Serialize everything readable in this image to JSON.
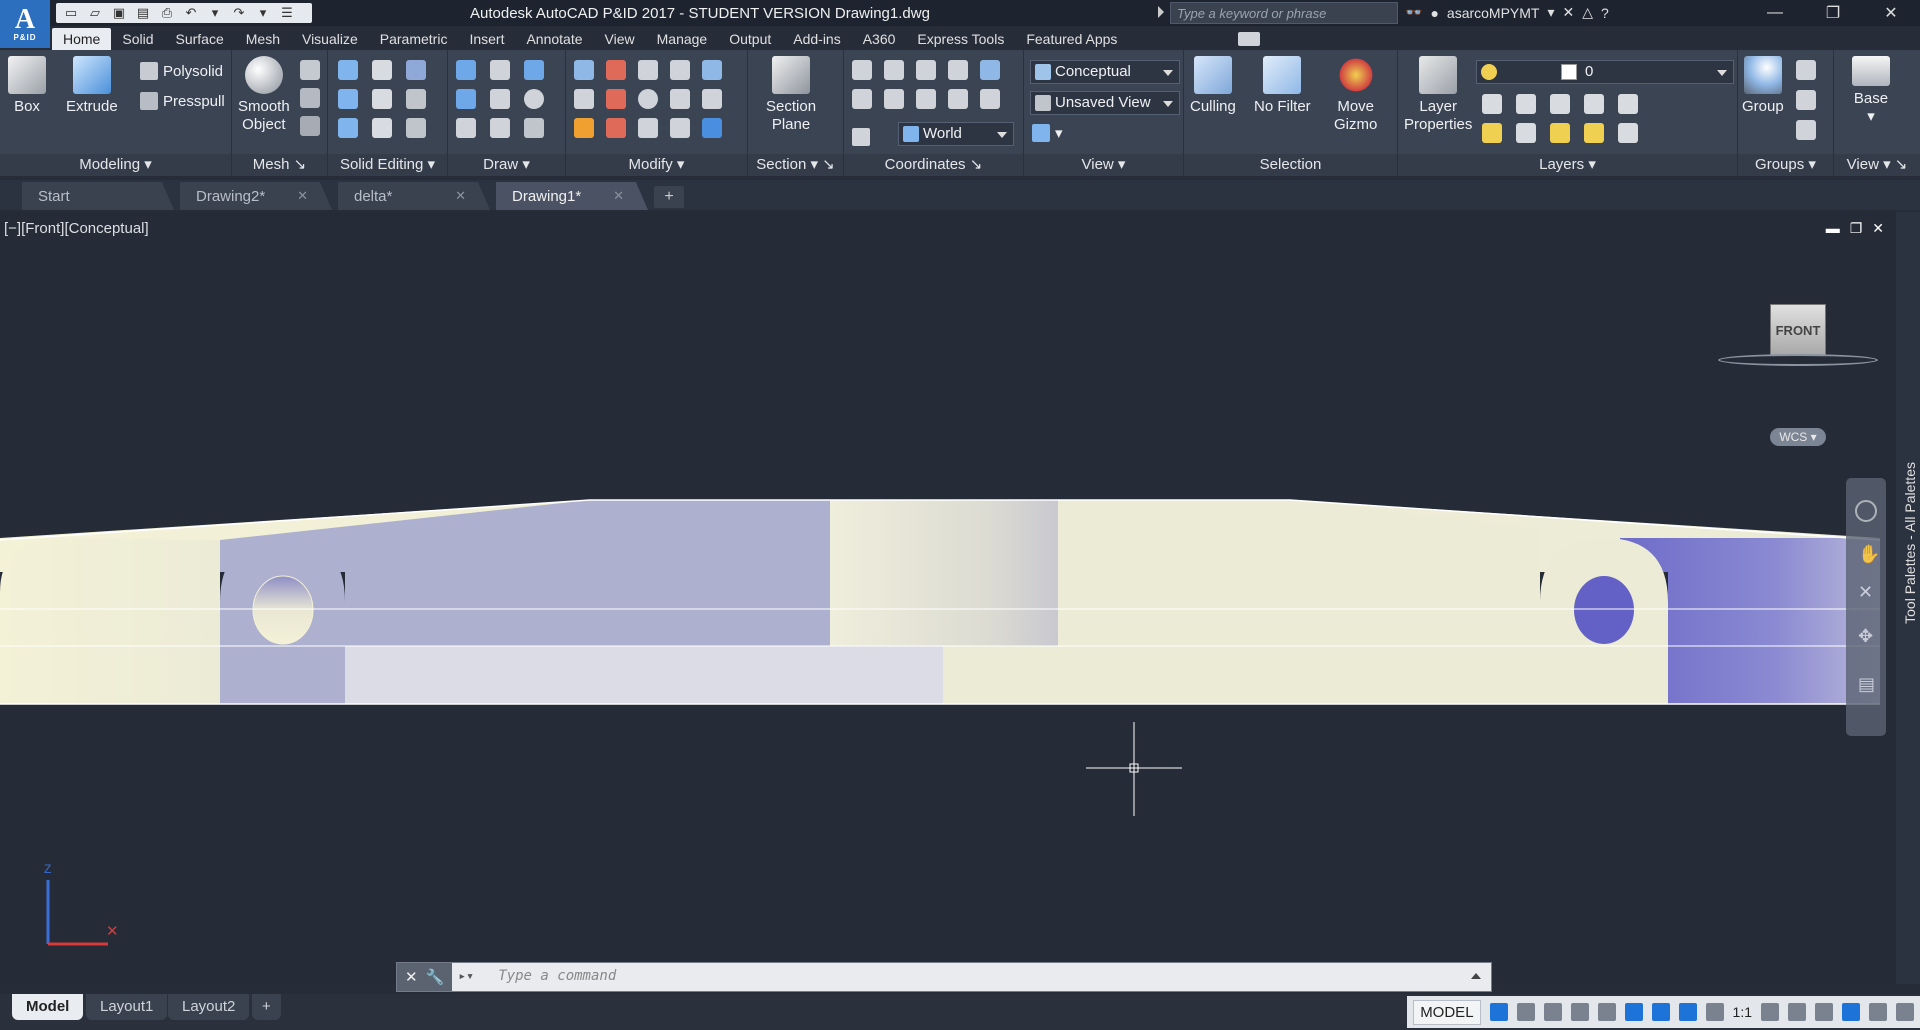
{
  "app": {
    "logo_letter": "A",
    "logo_sub": "P&ID",
    "window_title": "Autodesk AutoCAD P&ID 2017 - STUDENT VERSION    Drawing1.dwg",
    "search_placeholder": "Type a keyword or phrase",
    "username": "asarcoMPYMT"
  },
  "ribbon_tabs": [
    "Home",
    "Solid",
    "Surface",
    "Mesh",
    "Visualize",
    "Parametric",
    "Insert",
    "Annotate",
    "View",
    "Manage",
    "Output",
    "Add-ins",
    "A360",
    "Express Tools",
    "Featured Apps"
  ],
  "panels": {
    "modeling": {
      "title": "Modeling",
      "box": "Box",
      "extrude": "Extrude",
      "polysolid": "Polysolid",
      "presspull": "Presspull"
    },
    "mesh": {
      "title": "Mesh",
      "smooth_object_1": "Smooth",
      "smooth_object_2": "Object"
    },
    "solid_editing": {
      "title": "Solid Editing"
    },
    "draw": {
      "title": "Draw"
    },
    "modify": {
      "title": "Modify"
    },
    "section": {
      "title": "Section",
      "plane_1": "Section",
      "plane_2": "Plane"
    },
    "coordinates": {
      "title": "Coordinates",
      "world": "World"
    },
    "view": {
      "title": "View",
      "visual_style": "Conceptual",
      "named_view": "Unsaved View"
    },
    "selection": {
      "title": "Selection",
      "culling": "Culling",
      "no_filter": "No Filter",
      "move_gizmo_1": "Move",
      "move_gizmo_2": "Gizmo"
    },
    "layers": {
      "title": "Layers",
      "layer_properties_1": "Layer",
      "layer_properties_2": "Properties",
      "current_layer": "0"
    },
    "groups": {
      "title": "Groups",
      "group": "Group"
    },
    "view2": {
      "title": "View",
      "base": "Base"
    }
  },
  "doc_tabs": [
    {
      "label": "Start",
      "closable": false
    },
    {
      "label": "Drawing2*",
      "closable": true
    },
    {
      "label": "delta*",
      "closable": true
    },
    {
      "label": "Drawing1*",
      "closable": true,
      "active": true
    }
  ],
  "viewport": {
    "label": "[−][Front][Conceptual]",
    "viewcube_face": "FRONT",
    "wcs": "WCS",
    "ucs_z": "Z",
    "palette_label": "Tool Palettes - All Palettes"
  },
  "command_line": {
    "placeholder": "Type a command"
  },
  "layout_tabs": [
    "Model",
    "Layout1",
    "Layout2"
  ],
  "status": {
    "model": "MODEL",
    "scale": "1:1"
  },
  "colors": {
    "part_cream": "#ecebd6",
    "part_lavender": "#aeb0cf",
    "part_blue": "#6e6cc9",
    "accent_blue": "#1e73d8"
  }
}
